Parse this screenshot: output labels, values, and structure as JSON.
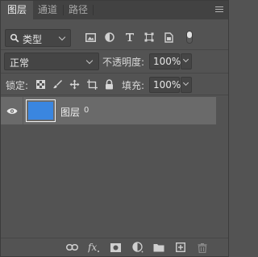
{
  "tabs": [
    {
      "label": "图层",
      "active": true
    },
    {
      "label": "通道",
      "active": false
    },
    {
      "label": "路径",
      "active": false
    }
  ],
  "filter": {
    "kind_label": "类型",
    "icons": [
      "pixel-layer-filter-icon",
      "adjustment-layer-filter-icon",
      "type-layer-filter-icon",
      "shape-layer-filter-icon",
      "smart-object-filter-icon",
      "filter-toggle-icon"
    ]
  },
  "blend": {
    "mode": "正常",
    "opacity_label": "不透明度:",
    "opacity_value": "100%"
  },
  "lock": {
    "label": "锁定:",
    "icons": [
      "lock-transparent-pixels-icon",
      "lock-image-pixels-icon",
      "lock-position-icon",
      "prevent-autonest-icon",
      "lock-all-icon"
    ],
    "fill_label": "填充:",
    "fill_value": "100%"
  },
  "layers": [
    {
      "name": "图层",
      "suffix": "0",
      "visible": true,
      "selected": true,
      "thumbnail_color": "#3a86e0"
    }
  ],
  "bottom_icons": [
    "link-layers-icon",
    "layer-style-fx-icon",
    "add-mask-icon",
    "new-fill-adjustment-icon",
    "new-group-icon",
    "new-layer-icon",
    "delete-layer-icon"
  ],
  "colors": {
    "panel_bg": "#535353",
    "tab_bar_bg": "#424242",
    "selected_row": "#6a6a6a",
    "accent_blue": "#3a86e0"
  }
}
